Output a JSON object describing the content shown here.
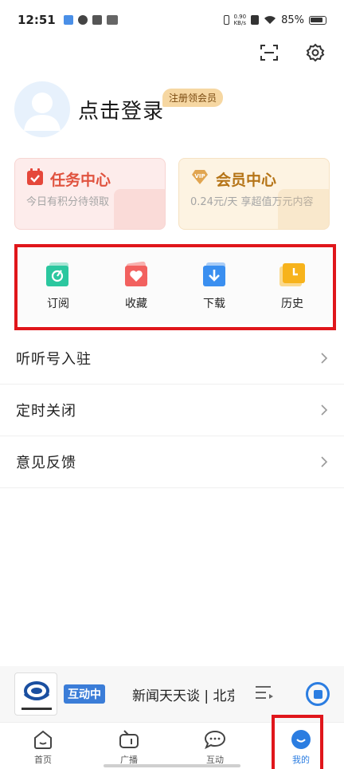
{
  "status_bar": {
    "time": "12:51",
    "net_speed_value": "0.90",
    "net_speed_unit": "KB/s",
    "battery": "85%"
  },
  "top_actions": {
    "scan_icon": "scan-icon",
    "settings_icon": "gear-icon"
  },
  "profile": {
    "login_text": "点击登录",
    "member_badge": "注册领会员"
  },
  "cards": {
    "task": {
      "title": "任务中心",
      "subtitle": "今日有积分待领取",
      "icon": "calendar-check-icon"
    },
    "vip": {
      "title": "会员中心",
      "subtitle": "0.24元/天 享超值万元内容",
      "icon": "vip-diamond-icon"
    }
  },
  "quick_entries": [
    {
      "label": "订阅",
      "icon": "subscribe-icon",
      "color": "#2bc79f"
    },
    {
      "label": "收藏",
      "icon": "favorite-icon",
      "color": "#f2615f"
    },
    {
      "label": "下载",
      "icon": "download-icon",
      "color": "#3a8ff0"
    },
    {
      "label": "历史",
      "icon": "history-icon",
      "color": "#f7b31c"
    }
  ],
  "menu": [
    {
      "label": "听听号入驻"
    },
    {
      "label": "定时关闭"
    },
    {
      "label": "意见反馈"
    }
  ],
  "player": {
    "live_badge": "互动中",
    "title": "新闻天天谈 | 北京新闻广播"
  },
  "tabs": [
    {
      "label": "首页",
      "icon": "home-icon"
    },
    {
      "label": "广播",
      "icon": "radio-icon"
    },
    {
      "label": "互动",
      "icon": "chat-icon"
    },
    {
      "label": "我的",
      "icon": "profile-icon",
      "active": true
    }
  ],
  "colors": {
    "accent": "#2b7de1",
    "highlight": "#e0161b"
  }
}
